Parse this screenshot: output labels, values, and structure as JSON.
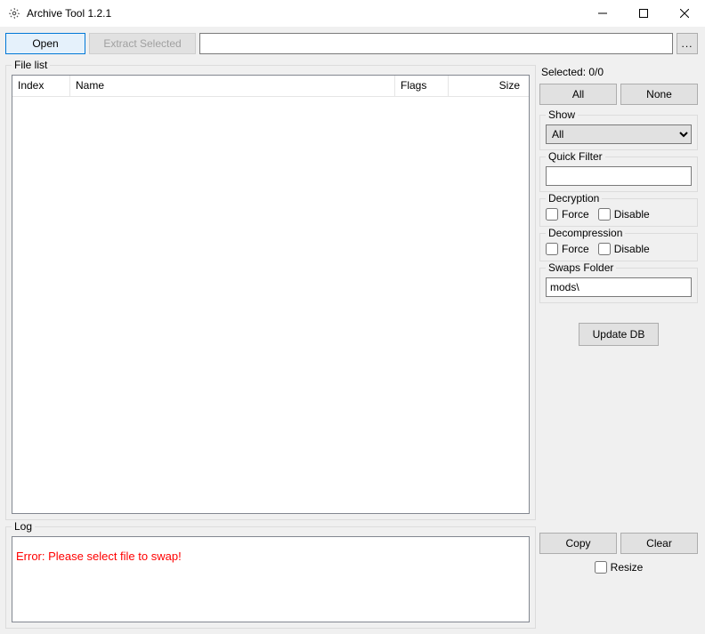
{
  "window": {
    "title": "Archive Tool 1.2.1"
  },
  "toolbar": {
    "open_label": "Open",
    "extract_label": "Extract Selected",
    "path_value": "",
    "browse_label": "..."
  },
  "file_list": {
    "legend": "File list",
    "columns": {
      "index": "Index",
      "name": "Name",
      "flags": "Flags",
      "size": "Size"
    }
  },
  "side": {
    "selected_label": "Selected: 0/0",
    "all_label": "All",
    "none_label": "None",
    "show": {
      "legend": "Show",
      "value": "All"
    },
    "quick_filter": {
      "legend": "Quick Filter",
      "value": ""
    },
    "decryption": {
      "legend": "Decryption",
      "force_label": "Force",
      "disable_label": "Disable"
    },
    "decompression": {
      "legend": "Decompression",
      "force_label": "Force",
      "disable_label": "Disable"
    },
    "swaps": {
      "legend": "Swaps Folder",
      "value": "mods\\"
    },
    "update_db_label": "Update DB"
  },
  "log": {
    "legend": "Log",
    "message": "Error: Please select file to swap!",
    "copy_label": "Copy",
    "clear_label": "Clear",
    "resize_label": "Resize"
  }
}
